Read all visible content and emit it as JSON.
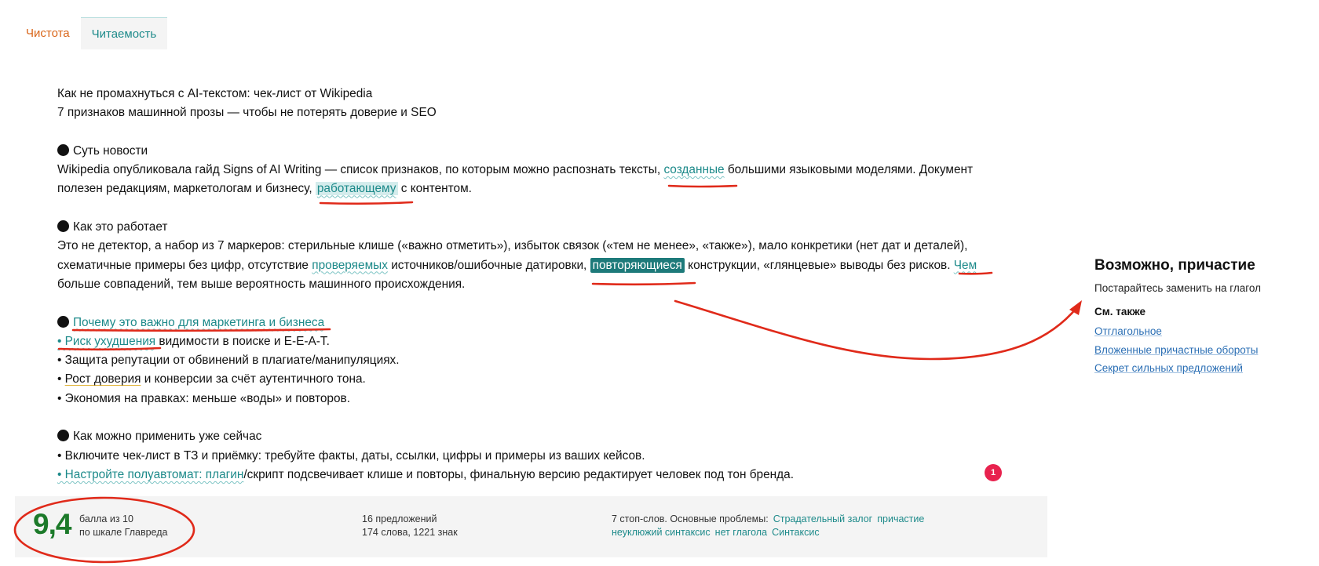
{
  "tabs": [
    {
      "label": "Чистота"
    },
    {
      "label": "Читаемость"
    }
  ],
  "article": {
    "title": "Как не промахнуться с AI-текстом: чек-лист от Wikipedia",
    "subtitle": "7 признаков машинной прозы — чтобы не потерять доверие и SEO",
    "s1_heading": "Суть новости",
    "s1_l1_a": "Wikipedia опубликовала гайд Signs of AI Writing — список признаков, по которым можно распознать тексты, ",
    "s1_l1_hl": "созданные",
    "s1_l1_b": " большими языковыми моделями. Документ",
    "s1_l2_a": "полезен редакциям, маркетологам и бизнесу, ",
    "s1_l2_hl": "работающему",
    "s1_l2_b": " с контентом.",
    "s2_heading": "Как это работает",
    "s2_l1": "Это не детектор, а набор из 7 маркеров: стерильные клише («важно отметить»), избыток связок («тем не менее», «также»), мало конкретики (нет дат и деталей),",
    "s2_l2_a": "схематичные примеры без цифр, отсутствие ",
    "s2_l2_hl1": "проверяемых",
    "s2_l2_b": " источников/ошибочные датировки, ",
    "s2_l2_hl2": "повторяющиеся",
    "s2_l2_c": " конструкции, «глянцевые» выводы без рисков. ",
    "s2_l2_hl3": "Чем",
    "s2_l3": "больше совпадений, тем выше вероятность машинного происхождения.",
    "s3_heading": "Почему это важно для маркетинга и бизнеса",
    "s3_b1_hl": "• Риск ухудшения",
    "s3_b1_rest": " видимости в поиске и E-E-A-T.",
    "s3_b2": "• Защита репутации от обвинений в плагиате/манипуляциях.",
    "s3_b3_a": "• ",
    "s3_b3_hl": "Рост доверия",
    "s3_b3_b": " и конверсии за счёт аутентичного тона.",
    "s3_b4": "• Экономия на правках: меньше «воды» и повторов.",
    "s4_heading": "Как можно применить уже сейчас",
    "s4_b1": "• Включите чек-лист в ТЗ и приёмку: требуйте факты, даты, ссылки, цифры и примеры из ваших кейсов.",
    "s4_b2_hl": "• Настройте полуавтомат: плагин",
    "s4_b2_rest": "/скрипт подсвечивает клише и повторы, финальную версию редактирует человек под тон бренда."
  },
  "badge_count": "1",
  "footer": {
    "score": "9,4",
    "score_line1": "балла из 10",
    "score_line2": "по шкале Главреда",
    "sentences": "16 предложений",
    "words": "174 слова, 1221 знак",
    "problems_prefix": "7 стоп-слов. Основные проблемы:",
    "problems_row1": [
      "Страдательный залог",
      "причастие"
    ],
    "problems_row2": [
      "неуклюжий синтаксис",
      "нет глагола",
      "Синтаксис"
    ]
  },
  "sidebar": {
    "title": "Возможно, причастие",
    "hint": "Постарайтесь заменить на глагол",
    "see_also": "См. также",
    "links": [
      "Отглагольное",
      "Вложенные причастные обороты",
      "Секрет сильных предложений"
    ]
  },
  "colors": {
    "accent_teal": "#1d8a8a",
    "tab_orange": "#d9661a",
    "score_green": "#1c7a2a",
    "annotation_red": "#e02a1a",
    "badge_red": "#e8224e",
    "link_blue": "#2a6eb4"
  },
  "icons": {
    "bullet": "black-circle-icon",
    "badge": "notification-count-icon"
  }
}
